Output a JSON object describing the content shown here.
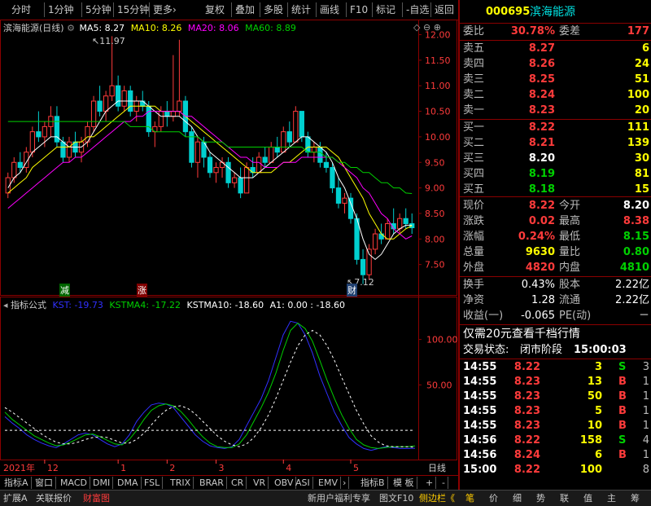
{
  "toolbar": {
    "left": [
      "分时",
      "1分钟",
      "5分钟",
      "15分钟",
      "更多›"
    ],
    "right": [
      "复权",
      "叠加",
      "多股",
      "统计",
      "画线",
      "F10",
      "标记",
      "-自选",
      "返回"
    ]
  },
  "main_legend": {
    "title": "滨海能源(日线)",
    "ma5": "MA5: 8.27",
    "ma10": "MA10: 8.26",
    "ma20": "MA20: 8.06",
    "ma60": "MA60: 8.89"
  },
  "ind_legend": {
    "title": "指标公式",
    "kst": "KST: -19.73",
    "kstma4": "KSTMA4: -17.22",
    "kstma10": "KSTMA10: -18.60",
    "a1": "A1: 0.00 : -18.60"
  },
  "markers": {
    "high_label": "11.97",
    "low_label": "7.12",
    "jian": "减",
    "zhang": "涨",
    "cai": "财"
  },
  "xaxis": {
    "year_label": "2021年",
    "months": [
      "12",
      "1",
      "2",
      "3",
      "4",
      "5"
    ],
    "period": "日线"
  },
  "chart_data": [
    {
      "type": "candlestick",
      "title": "滨海能源(日线)",
      "ylim": [
        7.0,
        12.2
      ],
      "yticks": [
        12.0,
        11.5,
        11.0,
        10.5,
        10.0,
        9.5,
        9.0,
        8.5,
        8.0,
        7.5
      ],
      "ohlc": [
        [
          8.9,
          9.3,
          8.8,
          9.2
        ],
        [
          9.2,
          9.6,
          9.1,
          9.5
        ],
        [
          9.5,
          9.7,
          9.3,
          9.4
        ],
        [
          9.4,
          9.8,
          9.3,
          9.7
        ],
        [
          9.7,
          10.2,
          9.6,
          10.1
        ],
        [
          10.1,
          10.5,
          9.9,
          10.0
        ],
        [
          10.0,
          10.3,
          9.8,
          10.2
        ],
        [
          10.2,
          10.6,
          10.0,
          10.4
        ],
        [
          10.4,
          10.6,
          9.8,
          9.9
        ],
        [
          9.9,
          10.0,
          9.5,
          9.6
        ],
        [
          9.6,
          10.0,
          9.5,
          9.9
        ],
        [
          9.9,
          10.1,
          9.6,
          9.7
        ],
        [
          9.7,
          10.0,
          9.5,
          9.9
        ],
        [
          9.9,
          10.3,
          9.8,
          10.2
        ],
        [
          10.2,
          10.8,
          10.1,
          10.7
        ],
        [
          10.7,
          11.0,
          10.4,
          10.5
        ],
        [
          10.5,
          10.9,
          10.3,
          10.8
        ],
        [
          10.8,
          11.97,
          10.7,
          11.0
        ],
        [
          11.0,
          11.2,
          10.5,
          10.6
        ],
        [
          10.6,
          11.0,
          10.5,
          10.9
        ],
        [
          10.9,
          11.0,
          10.4,
          10.5
        ],
        [
          10.5,
          10.8,
          10.3,
          10.7
        ],
        [
          10.7,
          10.9,
          10.5,
          10.6
        ],
        [
          10.6,
          10.7,
          10.0,
          10.1
        ],
        [
          10.1,
          10.3,
          9.8,
          10.2
        ],
        [
          10.2,
          10.6,
          10.1,
          10.5
        ],
        [
          10.5,
          10.7,
          10.2,
          10.4
        ],
        [
          10.4,
          11.6,
          10.3,
          10.5
        ],
        [
          10.5,
          11.9,
          10.4,
          10.7
        ],
        [
          10.7,
          10.8,
          10.0,
          10.1
        ],
        [
          10.1,
          10.2,
          9.4,
          9.5
        ],
        [
          9.5,
          10.0,
          9.2,
          9.9
        ],
        [
          9.9,
          10.0,
          9.4,
          9.6
        ],
        [
          9.6,
          9.7,
          9.2,
          9.3
        ],
        [
          9.3,
          9.5,
          9.1,
          9.4
        ],
        [
          9.4,
          9.6,
          9.2,
          9.5
        ],
        [
          9.5,
          9.6,
          9.0,
          9.1
        ],
        [
          9.1,
          9.3,
          9.0,
          9.2
        ],
        [
          9.2,
          9.4,
          8.8,
          8.9
        ],
        [
          8.9,
          9.5,
          8.9,
          9.4
        ],
        [
          9.4,
          9.6,
          9.2,
          9.3
        ],
        [
          9.3,
          9.7,
          9.3,
          9.6
        ],
        [
          9.6,
          9.8,
          9.4,
          9.5
        ],
        [
          9.5,
          9.9,
          9.5,
          9.8
        ],
        [
          9.8,
          10.0,
          9.6,
          9.7
        ],
        [
          9.7,
          10.2,
          9.7,
          10.1
        ],
        [
          10.1,
          10.3,
          9.8,
          9.9
        ],
        [
          9.9,
          10.6,
          9.9,
          10.5
        ],
        [
          10.5,
          10.5,
          9.9,
          10.0
        ],
        [
          10.0,
          10.1,
          9.6,
          9.7
        ],
        [
          9.7,
          9.9,
          9.5,
          9.8
        ],
        [
          9.8,
          9.9,
          9.4,
          9.5
        ],
        [
          9.5,
          9.7,
          9.3,
          9.4
        ],
        [
          9.4,
          9.5,
          8.9,
          9.0
        ],
        [
          9.0,
          9.2,
          8.6,
          8.7
        ],
        [
          8.7,
          8.9,
          8.5,
          8.8
        ],
        [
          8.8,
          8.9,
          8.3,
          8.4
        ],
        [
          8.4,
          8.5,
          7.5,
          7.6
        ],
        [
          7.6,
          7.8,
          7.12,
          7.3
        ],
        [
          7.3,
          7.9,
          7.2,
          7.8
        ],
        [
          7.8,
          8.2,
          7.7,
          8.1
        ],
        [
          8.1,
          8.3,
          7.9,
          8.0
        ],
        [
          8.0,
          8.4,
          8.0,
          8.3
        ],
        [
          8.3,
          8.6,
          8.1,
          8.2
        ],
        [
          8.2,
          8.5,
          8.1,
          8.4
        ],
        [
          8.4,
          8.6,
          8.2,
          8.3
        ],
        [
          8.3,
          8.5,
          8.1,
          8.22
        ]
      ],
      "series": [
        {
          "name": "MA5",
          "color": "#ffffff",
          "values": [
            9.0,
            9.2,
            9.3,
            9.5,
            9.7,
            9.8,
            9.9,
            10.0,
            10.0,
            9.9,
            9.8,
            9.8,
            9.8,
            9.9,
            10.1,
            10.3,
            10.5,
            10.6,
            10.7,
            10.7,
            10.7,
            10.7,
            10.7,
            10.6,
            10.5,
            10.4,
            10.4,
            10.4,
            10.4,
            10.3,
            10.2,
            10.0,
            9.9,
            9.7,
            9.6,
            9.5,
            9.4,
            9.3,
            9.2,
            9.2,
            9.2,
            9.3,
            9.4,
            9.5,
            9.6,
            9.7,
            9.8,
            9.9,
            10.0,
            10.0,
            9.9,
            9.8,
            9.7,
            9.5,
            9.2,
            9.0,
            8.7,
            8.4,
            8.0,
            7.7,
            7.6,
            7.7,
            7.9,
            8.1,
            8.2,
            8.27,
            8.27
          ]
        },
        {
          "name": "MA10",
          "color": "#ffff00",
          "values": [
            8.9,
            9.0,
            9.1,
            9.2,
            9.4,
            9.5,
            9.6,
            9.7,
            9.8,
            9.8,
            9.8,
            9.9,
            9.9,
            10.0,
            10.0,
            10.1,
            10.2,
            10.3,
            10.4,
            10.5,
            10.6,
            10.6,
            10.6,
            10.6,
            10.6,
            10.5,
            10.5,
            10.5,
            10.5,
            10.4,
            10.3,
            10.2,
            10.1,
            10.0,
            9.9,
            9.8,
            9.7,
            9.6,
            9.5,
            9.4,
            9.3,
            9.3,
            9.3,
            9.3,
            9.4,
            9.5,
            9.5,
            9.6,
            9.7,
            9.8,
            9.8,
            9.8,
            9.8,
            9.7,
            9.6,
            9.4,
            9.2,
            9.0,
            8.8,
            8.5,
            8.3,
            8.1,
            8.0,
            8.0,
            8.1,
            8.2,
            8.26
          ]
        },
        {
          "name": "MA20",
          "color": "#ff00ff",
          "values": [
            8.6,
            8.7,
            8.8,
            8.9,
            9.0,
            9.1,
            9.2,
            9.3,
            9.4,
            9.5,
            9.5,
            9.6,
            9.6,
            9.7,
            9.8,
            9.9,
            10.0,
            10.1,
            10.2,
            10.3,
            10.3,
            10.4,
            10.4,
            10.5,
            10.5,
            10.5,
            10.5,
            10.5,
            10.5,
            10.4,
            10.4,
            10.3,
            10.2,
            10.1,
            10.0,
            9.9,
            9.8,
            9.7,
            9.6,
            9.6,
            9.5,
            9.5,
            9.4,
            9.4,
            9.4,
            9.5,
            9.5,
            9.5,
            9.6,
            9.6,
            9.6,
            9.6,
            9.6,
            9.6,
            9.5,
            9.4,
            9.3,
            9.2,
            9.0,
            8.9,
            8.7,
            8.5,
            8.4,
            8.2,
            8.1,
            8.0,
            8.06
          ]
        },
        {
          "name": "MA60",
          "color": "#00d000",
          "values": [
            10.3,
            10.3,
            10.3,
            10.3,
            10.3,
            10.3,
            10.3,
            10.3,
            10.3,
            10.3,
            10.3,
            10.3,
            10.3,
            10.3,
            10.3,
            10.3,
            10.3,
            10.3,
            10.3,
            10.3,
            10.2,
            10.2,
            10.2,
            10.2,
            10.1,
            10.1,
            10.1,
            10.1,
            10.1,
            10.0,
            10.0,
            10.0,
            9.9,
            9.9,
            9.9,
            9.9,
            9.8,
            9.8,
            9.8,
            9.8,
            9.8,
            9.8,
            9.8,
            9.8,
            9.8,
            9.8,
            9.8,
            9.8,
            9.8,
            9.7,
            9.7,
            9.7,
            9.6,
            9.6,
            9.5,
            9.5,
            9.4,
            9.4,
            9.3,
            9.3,
            9.2,
            9.1,
            9.1,
            9.0,
            9.0,
            8.9,
            8.89
          ]
        }
      ]
    },
    {
      "type": "line",
      "title": "指标公式",
      "ylim": [
        -25,
        140
      ],
      "yticks": [
        100.0,
        50.0
      ],
      "series": [
        {
          "name": "KST",
          "color": "#3030ff",
          "values": [
            15,
            8,
            2,
            -5,
            -10,
            -14,
            -17,
            -19,
            -15,
            -10,
            -5,
            -3,
            -5,
            -10,
            -15,
            -18,
            -15,
            -5,
            10,
            20,
            28,
            30,
            29,
            25,
            15,
            5,
            -5,
            -12,
            -17,
            -19,
            -20,
            -18,
            -10,
            5,
            20,
            35,
            55,
            80,
            105,
            120,
            118,
            105,
            85,
            60,
            40,
            20,
            5,
            -8,
            -15,
            -20,
            -22,
            -20,
            -18,
            -19,
            -20,
            -20,
            -19.73
          ]
        },
        {
          "name": "KSTMA4",
          "color": "#00d000",
          "values": [
            20,
            12,
            6,
            0,
            -6,
            -10,
            -14,
            -17,
            -16,
            -13,
            -9,
            -5,
            -4,
            -7,
            -11,
            -15,
            -16,
            -10,
            0,
            12,
            22,
            27,
            29,
            27,
            21,
            12,
            2,
            -7,
            -14,
            -18,
            -19,
            -19,
            -15,
            -5,
            10,
            25,
            42,
            63,
            88,
            110,
            118,
            112,
            98,
            77,
            55,
            35,
            17,
            2,
            -10,
            -16,
            -19,
            -20,
            -19,
            -18,
            -18,
            -18,
            -17.22
          ]
        },
        {
          "name": "KSTMA10",
          "color": "#ffffff",
          "values": [
            25,
            20,
            14,
            8,
            2,
            -4,
            -9,
            -13,
            -15,
            -15,
            -13,
            -10,
            -8,
            -7,
            -8,
            -11,
            -14,
            -14,
            -10,
            -3,
            6,
            15,
            22,
            26,
            27,
            24,
            18,
            10,
            2,
            -6,
            -12,
            -16,
            -18,
            -15,
            -8,
            3,
            17,
            35,
            55,
            75,
            93,
            105,
            110,
            105,
            93,
            77,
            58,
            40,
            22,
            7,
            -6,
            -13,
            -17,
            -18,
            -18,
            -18,
            -18.6
          ]
        },
        {
          "name": "A1",
          "color": "#ffffff",
          "values": [
            0,
            0,
            0,
            0,
            0,
            0,
            0,
            0,
            0,
            0,
            0,
            0,
            0,
            0,
            0,
            0,
            0,
            0,
            0,
            0,
            0,
            0,
            0,
            0,
            0,
            0,
            0,
            0,
            0,
            0,
            0,
            0,
            0,
            0,
            0,
            0,
            0,
            0,
            0,
            0,
            0,
            0,
            0,
            0,
            0,
            0,
            0,
            0,
            0,
            0,
            0,
            0,
            0,
            0,
            0,
            0,
            0
          ]
        }
      ]
    }
  ],
  "panel": {
    "code": "000695",
    "name": "滨海能源",
    "weibi_label": "委比",
    "weibi": "30.78%",
    "weicha_label": "委差",
    "weicha": "177",
    "asks": [
      {
        "label": "卖五",
        "price": "8.27",
        "vol": "6"
      },
      {
        "label": "卖四",
        "price": "8.26",
        "vol": "24"
      },
      {
        "label": "卖三",
        "price": "8.25",
        "vol": "51"
      },
      {
        "label": "卖二",
        "price": "8.24",
        "vol": "100"
      },
      {
        "label": "卖一",
        "price": "8.23",
        "vol": "20"
      }
    ],
    "bids": [
      {
        "label": "买一",
        "price": "8.22",
        "vol": "111"
      },
      {
        "label": "买二",
        "price": "8.21",
        "vol": "139"
      },
      {
        "label": "买三",
        "price": "8.20",
        "vol": "30"
      },
      {
        "label": "买四",
        "price": "8.19",
        "vol": "81"
      },
      {
        "label": "买五",
        "price": "8.18",
        "vol": "15"
      }
    ],
    "quote": [
      {
        "l1": "现价",
        "v1": "8.22",
        "l2": "今开",
        "v2": "8.20"
      },
      {
        "l1": "涨跌",
        "v1": "0.02",
        "l2": "最高",
        "v2": "8.38"
      },
      {
        "l1": "涨幅",
        "v1": "0.24%",
        "l2": "最低",
        "v2": "8.15"
      },
      {
        "l1": "总量",
        "v1": "9630",
        "l2": "量比",
        "v2": "0.80"
      },
      {
        "l1": "外盘",
        "v1": "4820",
        "l2": "内盘",
        "v2": "4810"
      }
    ],
    "fin": [
      {
        "l1": "换手",
        "v1": "0.43%",
        "l2": "股本",
        "v2": "2.22亿"
      },
      {
        "l1": "净资",
        "v1": "1.28",
        "l2": "流通",
        "v2": "2.22亿"
      },
      {
        "l1": "收益(一)",
        "v1": "-0.065",
        "l2": "PE(动)",
        "v2": "－"
      }
    ],
    "promo": "仅需20元查看千档行情",
    "state_label": "交易状态:",
    "state": "闭市阶段",
    "state_time": "15:00:03",
    "ticks": [
      {
        "t": "14:55",
        "p": "8.22",
        "v": "3",
        "s": "S",
        "n": "3"
      },
      {
        "t": "14:55",
        "p": "8.23",
        "v": "13",
        "s": "B",
        "n": "1"
      },
      {
        "t": "14:55",
        "p": "8.23",
        "v": "50",
        "s": "B",
        "n": "1"
      },
      {
        "t": "14:55",
        "p": "8.23",
        "v": "5",
        "s": "B",
        "n": "1"
      },
      {
        "t": "14:55",
        "p": "8.23",
        "v": "10",
        "s": "B",
        "n": "1"
      },
      {
        "t": "14:56",
        "p": "8.22",
        "v": "158",
        "s": "S",
        "n": "4"
      },
      {
        "t": "14:56",
        "p": "8.24",
        "v": "6",
        "s": "B",
        "n": "1"
      },
      {
        "t": "15:00",
        "p": "8.22",
        "v": "100",
        "s": "",
        "n": "8"
      }
    ]
  },
  "indicator_tabs": [
    "指标A",
    "窗口",
    "MACD",
    "DMI",
    "DMA",
    "FSL",
    "TRIX",
    "BRAR",
    "CR",
    "VR",
    "OBV",
    "ASI",
    "EMV",
    "›",
    "指标B",
    "模 板",
    "+",
    "-"
  ],
  "statusbar": {
    "left": [
      "扩展A",
      "关联报价",
      "财富图"
    ],
    "right": [
      "新用户福利专享",
      "图文F10",
      "侧边栏《"
    ],
    "tabs": [
      "笔",
      "价",
      "细",
      "势",
      "联",
      "值",
      "主",
      "筹"
    ]
  },
  "colors": {
    "up": "#ff3b3b",
    "down": "#00d0d0",
    "frame": "#8b0000",
    "grid": "#8b0000"
  }
}
